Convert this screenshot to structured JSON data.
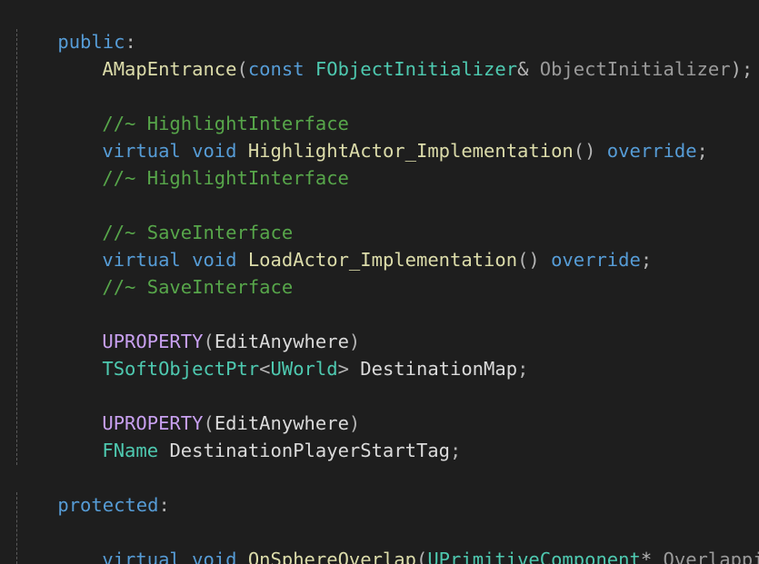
{
  "code": {
    "access_public": "public",
    "access_protected": "protected",
    "colon": ":",
    "ctor": {
      "name": "AMapEntrance",
      "open": "(",
      "const_kw": "const",
      "param_type": "FObjectInitializer",
      "amp": "&",
      "param_name": "ObjectInitializer",
      "close": ");"
    },
    "highlight": {
      "comment_open": "//~ HighlightInterface",
      "virtual_kw": "virtual",
      "void_kw": "void",
      "func": "HighlightActor_Implementation",
      "parens": "()",
      "override_kw": "override",
      "semi": ";",
      "comment_close": "//~ HighlightInterface"
    },
    "save": {
      "comment_open": "//~ SaveInterface",
      "virtual_kw": "virtual",
      "void_kw": "void",
      "func": "LoadActor_Implementation",
      "parens": "()",
      "override_kw": "override",
      "semi": ";",
      "comment_close": "//~ SaveInterface"
    },
    "prop1": {
      "macro": "UPROPERTY",
      "open": "(",
      "spec": "EditAnywhere",
      "close": ")",
      "type": "TSoftObjectPtr",
      "lt": "<",
      "inner_type": "UWorld",
      "gt": ">",
      "name": "DestinationMap",
      "semi": ";"
    },
    "prop2": {
      "macro": "UPROPERTY",
      "open": "(",
      "spec": "EditAnywhere",
      "close": ")",
      "type": "FName",
      "name": "DestinationPlayerStartTag",
      "semi": ";"
    },
    "overlap": {
      "virtual_kw": "virtual",
      "void_kw": "void",
      "func": "OnSphereOverlap",
      "open": "(",
      "param_type": "UPrimitiveComponent",
      "star": "*",
      "param_name": "OverlappingCom"
    }
  },
  "colors": {
    "background": "#1e1e1e",
    "keyword": "#569cd6",
    "type": "#4ec9b0",
    "function": "#dcdcaa",
    "comment": "#57a64a",
    "macro": "#bd63c5"
  }
}
